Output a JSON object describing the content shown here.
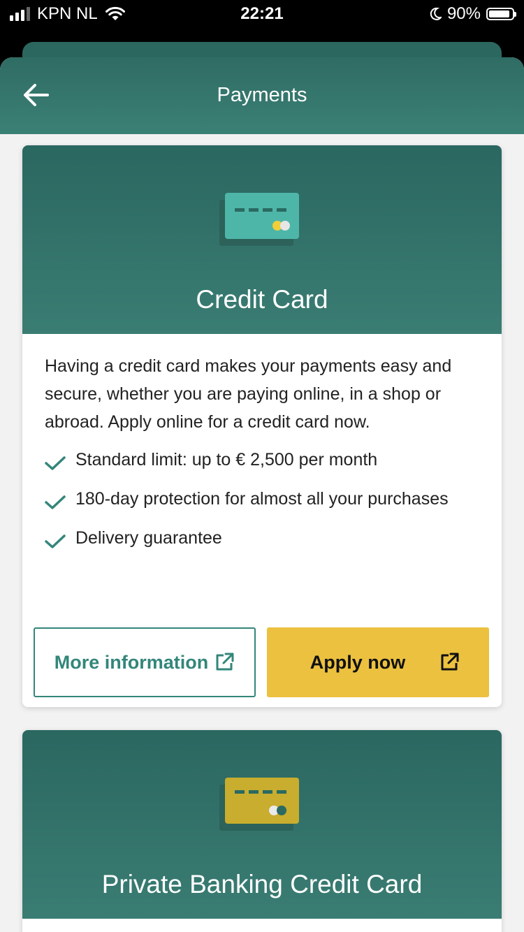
{
  "status_bar": {
    "carrier": "KPN NL",
    "time": "22:21",
    "battery_percent": "90%",
    "battery_level": 0.9
  },
  "nav": {
    "title": "Payments",
    "back_icon": "arrow-left-icon"
  },
  "cards": [
    {
      "title": "Credit Card",
      "icon": "credit-card-icon",
      "description": "Having a credit card makes your payments easy and secure, whether you are paying online, in a shop or abroad. Apply online for a credit card now.",
      "features": [
        "Standard limit: up to € 2,500 per month",
        "180-day protection for almost all your purchases",
        "Delivery guarantee"
      ],
      "more_label": "More information",
      "apply_label": "Apply now"
    },
    {
      "title": "Private Banking Credit Card",
      "icon": "gold-credit-card-icon"
    }
  ],
  "colors": {
    "primary_green": "#33867a",
    "header_green": "#2c675f",
    "apply_yellow": "#ebc13f"
  }
}
